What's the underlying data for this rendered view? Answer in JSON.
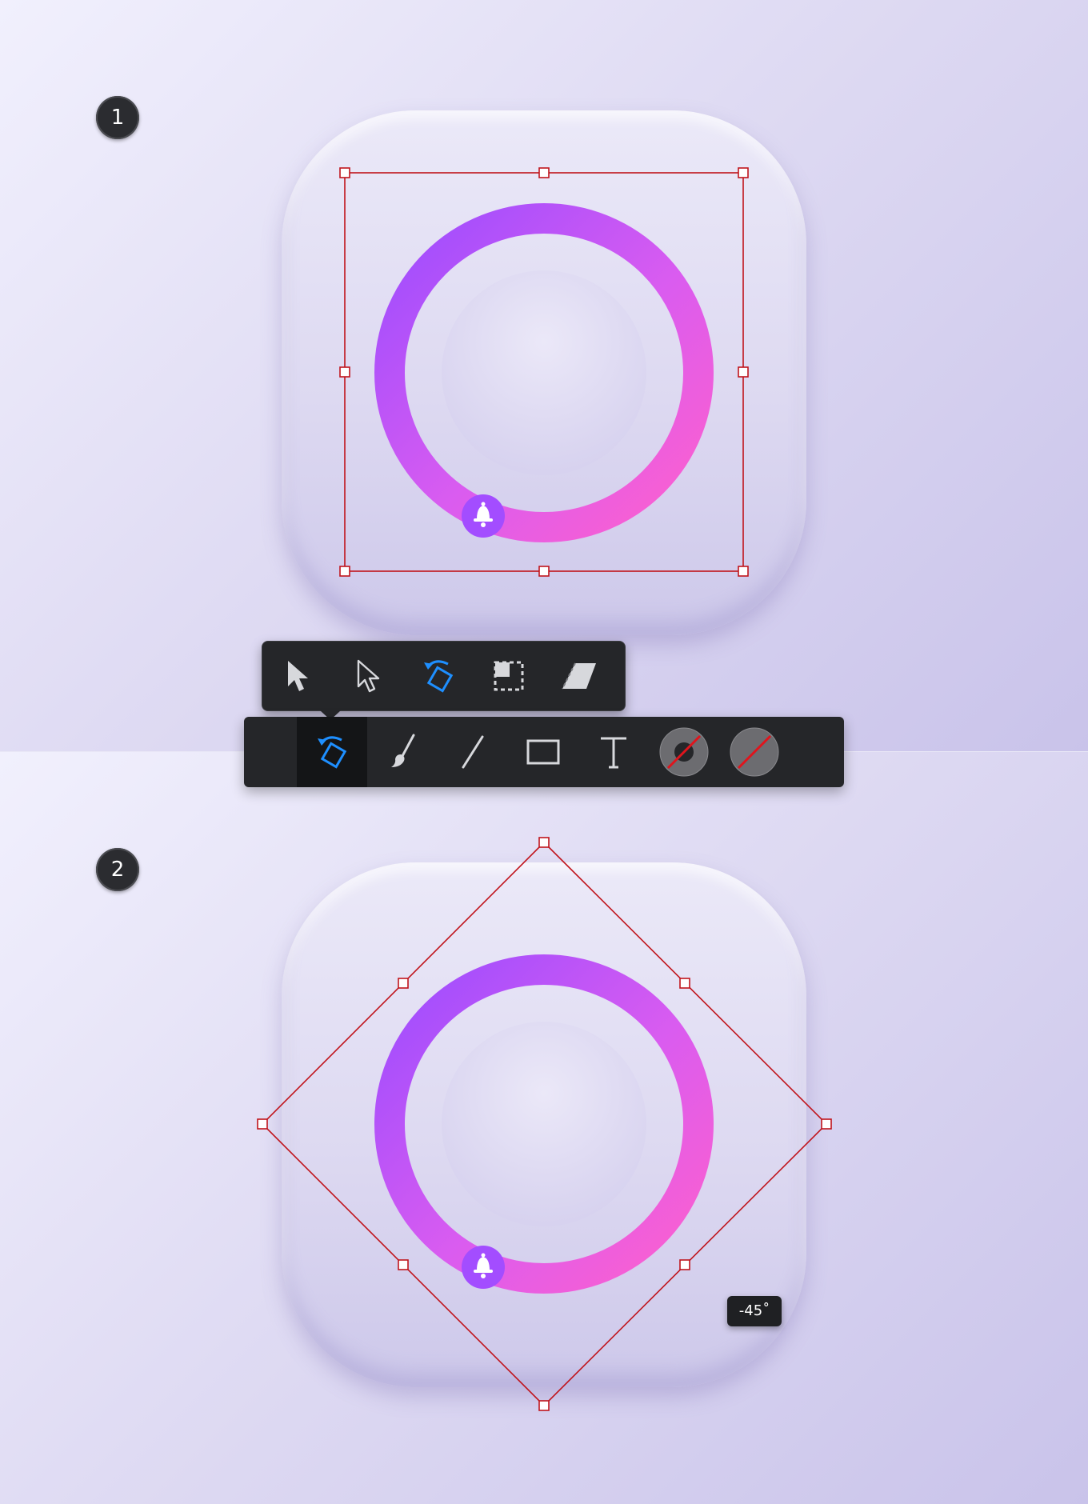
{
  "steps": [
    {
      "number": "1"
    },
    {
      "number": "2"
    }
  ],
  "colors": {
    "ring_start": "#a44dff",
    "ring_end": "#ff5fd0",
    "selection": "#c0141c",
    "accent_tool": "#1e8fff",
    "toolbar_bg": "#252629"
  },
  "toolbar": {
    "items": [
      {
        "icon": "rotate-icon",
        "active": true
      },
      {
        "icon": "brush-icon"
      },
      {
        "icon": "line-icon"
      },
      {
        "icon": "rectangle-icon"
      },
      {
        "icon": "text-icon"
      },
      {
        "icon": "stroke-color-icon"
      },
      {
        "icon": "fill-color-icon"
      }
    ]
  },
  "tool_popup": {
    "items": [
      {
        "icon": "selection-arrow-icon"
      },
      {
        "icon": "direct-selection-arrow-icon"
      },
      {
        "icon": "rotate-icon",
        "active": true
      },
      {
        "icon": "scale-icon"
      },
      {
        "icon": "shear-icon"
      }
    ]
  },
  "rotation_readout": "-45˚"
}
